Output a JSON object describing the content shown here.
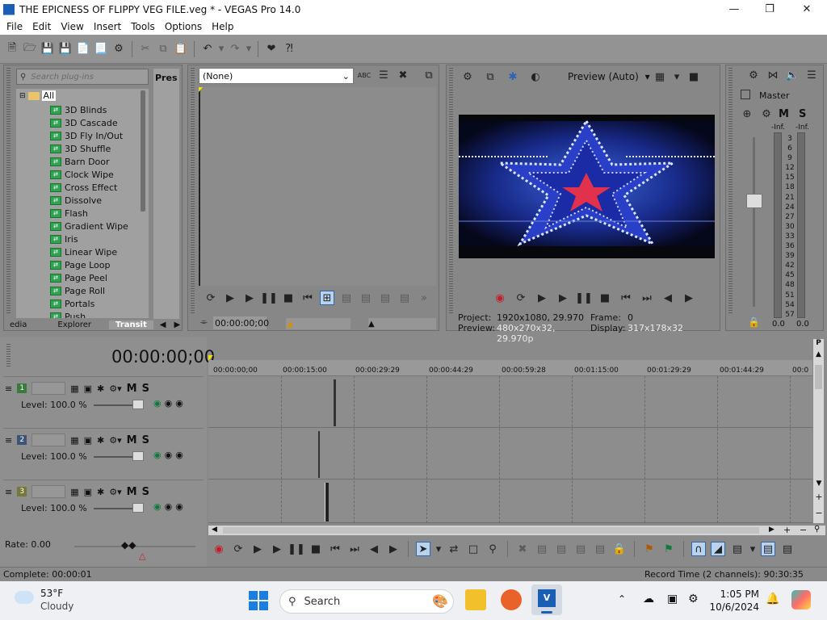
{
  "window": {
    "title": "THE EPICNESS OF FLIPPY VEG FILE.veg * - VEGAS Pro 14.0"
  },
  "menu": [
    "File",
    "Edit",
    "View",
    "Insert",
    "Tools",
    "Options",
    "Help"
  ],
  "transitions": {
    "search_placeholder": "Search plug-ins",
    "preset_label": "Pres",
    "root": "All",
    "items": [
      "3D Blinds",
      "3D Cascade",
      "3D Fly In/Out",
      "3D Shuffle",
      "Barn Door",
      "Clock Wipe",
      "Cross Effect",
      "Dissolve",
      "Flash",
      "Gradient Wipe",
      "Iris",
      "Linear Wipe",
      "Page Loop",
      "Page Peel",
      "Page Roll",
      "Portals",
      "Push"
    ],
    "tabs": [
      "edia",
      "Explorer",
      "Transit"
    ]
  },
  "trimmer": {
    "select_value": "(None)",
    "time": "00:00:00;00"
  },
  "preview": {
    "mode": "Preview (Auto)",
    "project_label": "Project:",
    "project_value": "1920x1080, 29.970",
    "frame_label": "Frame:",
    "frame_value": "0",
    "preview_label": "Preview:",
    "preview_value": "480x270x32, 29.970p",
    "display_label": "Display:",
    "display_value": "317x178x32"
  },
  "master": {
    "label": "Master",
    "inf_left": "-Inf.",
    "inf_right": "-Inf.",
    "scale": [
      "3",
      "6",
      "9",
      "12",
      "15",
      "18",
      "21",
      "24",
      "27",
      "30",
      "33",
      "36",
      "39",
      "42",
      "45",
      "48",
      "51",
      "54",
      "57"
    ],
    "value_left": "0.0",
    "value_right": "0.0",
    "m": "M",
    "s": "S"
  },
  "timeline": {
    "timecode": "00:00:00;00",
    "ruler": [
      "00:00:00;00",
      "00:00:15:00",
      "00:00:29:29",
      "00:00:44:29",
      "00:00:59:28",
      "00:01:15:00",
      "00:01:29:29",
      "00:01:44:29",
      "00:0"
    ],
    "tracks": [
      {
        "num": "1",
        "level": "Level: 100.0 %",
        "color": "#3a7a3a"
      },
      {
        "num": "2",
        "level": "Level: 100.0 %",
        "color": "#3a5577"
      },
      {
        "num": "3",
        "level": "Level: 100.0 %",
        "color": "#77773a"
      }
    ],
    "m": "M",
    "s": "S",
    "rate": "Rate: 0.00"
  },
  "status": {
    "complete": "Complete: 00:00:01",
    "record_time": "Record Time (2 channels): 90:30:35"
  },
  "taskbar": {
    "temp": "53°F",
    "weather": "Cloudy",
    "search": "Search",
    "time": "1:05 PM",
    "date": "10/6/2024"
  }
}
